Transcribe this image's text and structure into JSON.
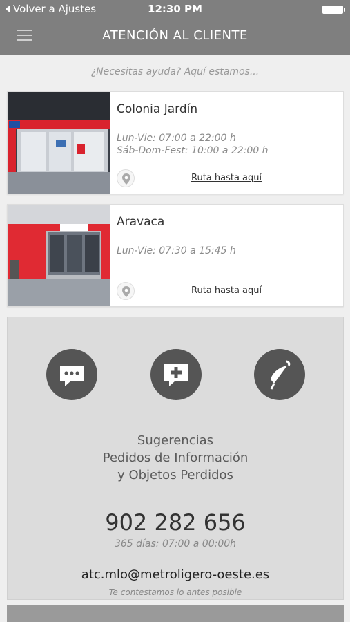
{
  "status_bar": {
    "back_label": "Volver a Ajustes",
    "time": "12:30 PM"
  },
  "nav": {
    "title": "ATENCIÓN AL CLIENTE",
    "menu_icon": "hamburger-menu-icon"
  },
  "subtitle": "¿Necesitas ayuda? Aquí estamos...",
  "offices": [
    {
      "name": "Colonia Jardín",
      "hours_1": "Lun-Vie: 07:00 a 22:00 h",
      "hours_2": "Sáb-Dom-Fest: 10:00 a 22:00 h",
      "route_label": "Ruta hasta aquí"
    },
    {
      "name": "Aravaca",
      "hours_1": "Lun-Vie: 07:30 a 15:45 h",
      "hours_2": "",
      "route_label": "Ruta hasta aquí"
    }
  ],
  "contact": {
    "icons": [
      "chat-bubble-icon",
      "add-message-icon",
      "lost-umbrella-icon"
    ],
    "line_1": "Sugerencias",
    "line_2": "Pedidos de Información",
    "line_3": "y Objetos Perdidos",
    "phone": "902 282 656",
    "phone_hours": "365 días: 07:00 a 00:00h",
    "email": "atc.mlo@metroligero-oeste.es",
    "email_note": "Te contestamos lo antes posible"
  },
  "colors": {
    "header": "#7f7f7f",
    "accent_red": "#d9232e",
    "icon_dark": "#555555",
    "panel": "#dcdcdc"
  }
}
